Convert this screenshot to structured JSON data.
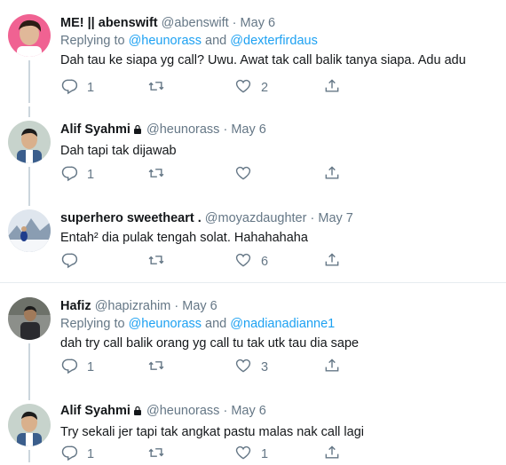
{
  "tweets": [
    {
      "name": "ME! || abenswift",
      "handle": "@abenswift",
      "dot": "·",
      "date": "May 6",
      "replying_prefix": "Replying to",
      "mention1": "@heunorass",
      "and": "and",
      "mention2": "@dexterfirdaus",
      "text": "Dah tau ke siapa yg call? Uwu. Awat tak call balik tanya siapa. Adu adu",
      "reply_count": "1",
      "retweet_count": "",
      "like_count": "2"
    },
    {
      "name": "Alif Syahmi",
      "handle": "@heunorass",
      "dot": "·",
      "date": "May 6",
      "text": "Dah tapi tak dijawab",
      "reply_count": "1",
      "retweet_count": "",
      "like_count": ""
    },
    {
      "name": "superhero sweetheart .",
      "handle": "@moyazdaughter",
      "dot": "·",
      "date": "May 7",
      "text": "Entah² dia pulak tengah solat. Hahahahaha",
      "reply_count": "",
      "retweet_count": "",
      "like_count": "6"
    },
    {
      "name": "Hafiz",
      "handle": "@hapizrahim",
      "dot": "·",
      "date": "May 6",
      "replying_prefix": "Replying to",
      "mention1": "@heunorass",
      "and": "and",
      "mention2": "@nadianadianne1",
      "text": "dah try call balik orang yg call tu tak utk tau dia sape",
      "reply_count": "1",
      "retweet_count": "",
      "like_count": "3"
    },
    {
      "name": "Alif Syahmi",
      "handle": "@heunorass",
      "dot": "·",
      "date": "May 6",
      "text": "Try sekali jer tapi tak angkat pastu malas nak call lagi",
      "reply_count": "1",
      "retweet_count": "",
      "like_count": "1"
    }
  ],
  "icons": {
    "reply": "reply-icon",
    "retweet": "retweet-icon",
    "like": "heart-icon",
    "share": "share-icon",
    "verified": "lock-icon"
  },
  "colors": {
    "accent": "#1da1f2",
    "muted": "#657786",
    "text": "#14171a",
    "divider": "#e6ecf0",
    "thread_line": "#ccd6dd"
  }
}
